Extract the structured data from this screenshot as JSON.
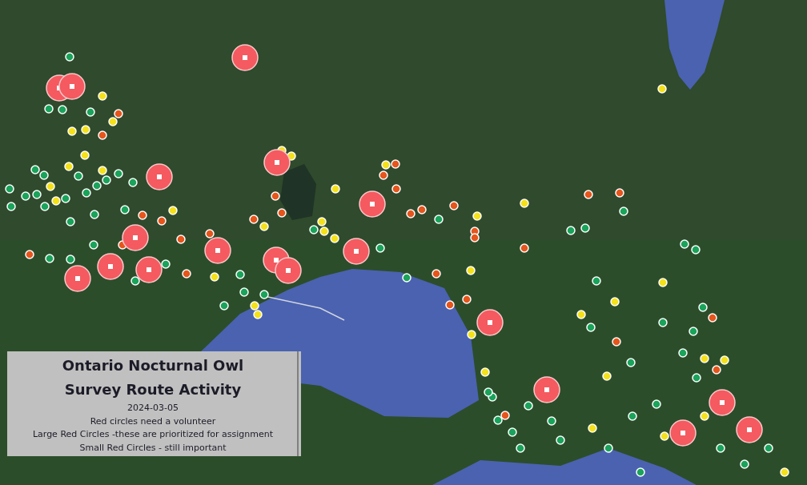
{
  "legend": {
    "title": [
      "Ontario Nocturnal Owl",
      "Survey Route Activity"
    ],
    "date": "2024-03-05",
    "notes": [
      "Red circles need a volunteer",
      "Large Red Circles -these are prioritized for assignment",
      "Small Red Circles - still important"
    ]
  }
}
